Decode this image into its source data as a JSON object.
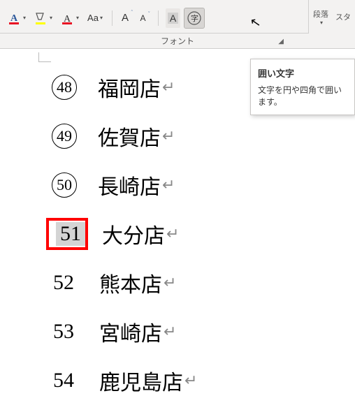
{
  "ribbon": {
    "group_label": "フォント",
    "items": {
      "font_color": "A",
      "highlight": "ab",
      "text_fill": "A",
      "change_case": "Aa",
      "grow_font": "A",
      "shrink_font": "A",
      "char_shading": "A",
      "enclose": "字"
    }
  },
  "top_right": {
    "style1": "段落",
    "style2": "スタ"
  },
  "tooltip": {
    "title": "囲い文字",
    "body": "文字を円や四角で囲います。"
  },
  "doc": {
    "lines": [
      {
        "num": "48",
        "circled": true,
        "text": "福岡店",
        "selected": false
      },
      {
        "num": "49",
        "circled": true,
        "text": "佐賀店",
        "selected": false
      },
      {
        "num": "50",
        "circled": true,
        "text": "長崎店",
        "selected": false
      },
      {
        "num": "51",
        "circled": false,
        "text": "大分店",
        "selected": true
      },
      {
        "num": "52",
        "circled": false,
        "text": "熊本店",
        "selected": false
      },
      {
        "num": "53",
        "circled": false,
        "text": "宮崎店",
        "selected": false
      },
      {
        "num": "54",
        "circled": false,
        "text": "鹿児島店",
        "selected": false
      }
    ],
    "para_mark": "↵"
  }
}
